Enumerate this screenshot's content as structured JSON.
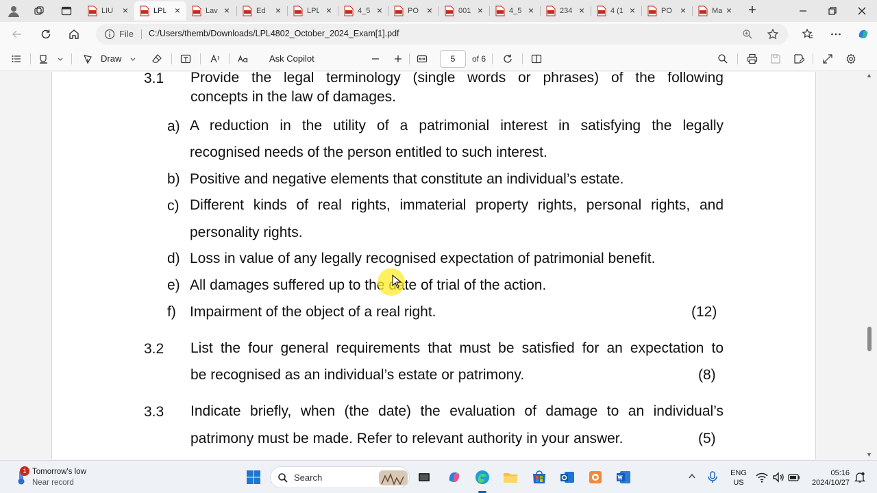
{
  "tabs": [
    {
      "label": "LIU",
      "active": false
    },
    {
      "label": "LPL",
      "active": true
    },
    {
      "label": "Lav",
      "active": false
    },
    {
      "label": "Ed",
      "active": false
    },
    {
      "label": "LPL",
      "active": false
    },
    {
      "label": "4_5",
      "active": false
    },
    {
      "label": "PO",
      "active": false
    },
    {
      "label": "001",
      "active": false
    },
    {
      "label": "4_5",
      "active": false
    },
    {
      "label": "234",
      "active": false
    },
    {
      "label": "4 (1",
      "active": false
    },
    {
      "label": "PO",
      "active": false
    },
    {
      "label": "Ma",
      "active": false
    }
  ],
  "address": {
    "scheme_label": "File",
    "url": "C:/Users/themb/Downloads/LPL4802_October_2024_Exam[1].pdf"
  },
  "pdf_toolbar": {
    "draw_label": "Draw",
    "copilot_label": "Ask Copilot",
    "current_page": "5",
    "page_count": "of 6"
  },
  "document": {
    "q31": {
      "number": "3.1",
      "line1": "Provide the legal terminology (single words or phrases) of the following",
      "line2": "concepts in the law of damages.",
      "items": [
        {
          "letter": "a)",
          "line1": "A reduction in the utility of a patrimonial interest in satisfying the legally",
          "line2": "recognised needs of the person entitled to such interest."
        },
        {
          "letter": "b)",
          "line1": "Positive and negative elements that constitute an individual’s estate."
        },
        {
          "letter": "c)",
          "line1": "Different kinds of real rights, immaterial property rights, personal rights, and",
          "line2": "personality rights."
        },
        {
          "letter": "d)",
          "line1": "Loss in value of any legally recognised expectation of patrimonial benefit."
        },
        {
          "letter": "e)",
          "line1": "All damages suffered up to the date of trial of the action."
        },
        {
          "letter": "f)",
          "line1": "Impairment of the object of a real right."
        }
      ],
      "marks": "(12)"
    },
    "q32": {
      "number": "3.2",
      "line1": "List the four general requirements that must be satisfied for an expectation to",
      "line2": "be recognised as an individual’s estate or patrimony.",
      "marks": "(8)"
    },
    "q33": {
      "number": "3.3",
      "line1": "Indicate briefly, when (the date) the evaluation of damage to an individual’s",
      "line2": "patrimony must be made. Refer to relevant authority in your answer.",
      "marks": "(5)"
    }
  },
  "taskbar": {
    "weather_badge": "1",
    "weather_title": "Tomorrow's low",
    "weather_sub": "Near record",
    "search_label": "Search",
    "lang_line1": "ENG",
    "lang_line2": "US",
    "time": "05:16",
    "date": "2024/10/27"
  },
  "colors": {
    "pdf_red": "#c42b1c",
    "accent": "#0067c0",
    "cursor_highlight": "#ffeb28"
  }
}
